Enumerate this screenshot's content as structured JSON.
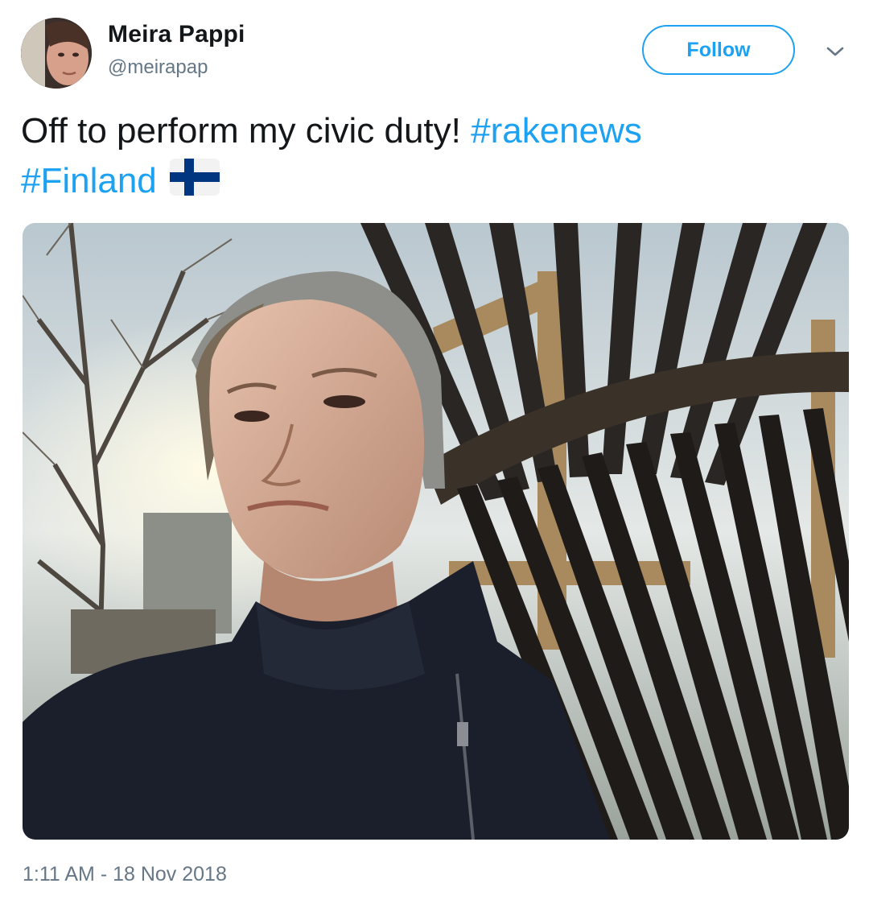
{
  "user": {
    "display_name": "Meira Pappi",
    "handle": "@meirapap",
    "avatar": "profile-photo"
  },
  "actions": {
    "follow_label": "Follow",
    "menu_icon": "chevron-down-icon"
  },
  "tweet": {
    "text": "Off to perform my civic duty! ",
    "hashtags": [
      "#rakenews",
      "#Finland"
    ],
    "emoji": "finland-flag-emoji",
    "media": "selfie-with-giant-rake-photo"
  },
  "meta": {
    "timestamp": "1:11 AM - 18 Nov 2018"
  },
  "colors": {
    "accent": "#1da1f2",
    "secondary_text": "#657786",
    "primary_text": "#14171a",
    "flag_blue": "#003580"
  }
}
